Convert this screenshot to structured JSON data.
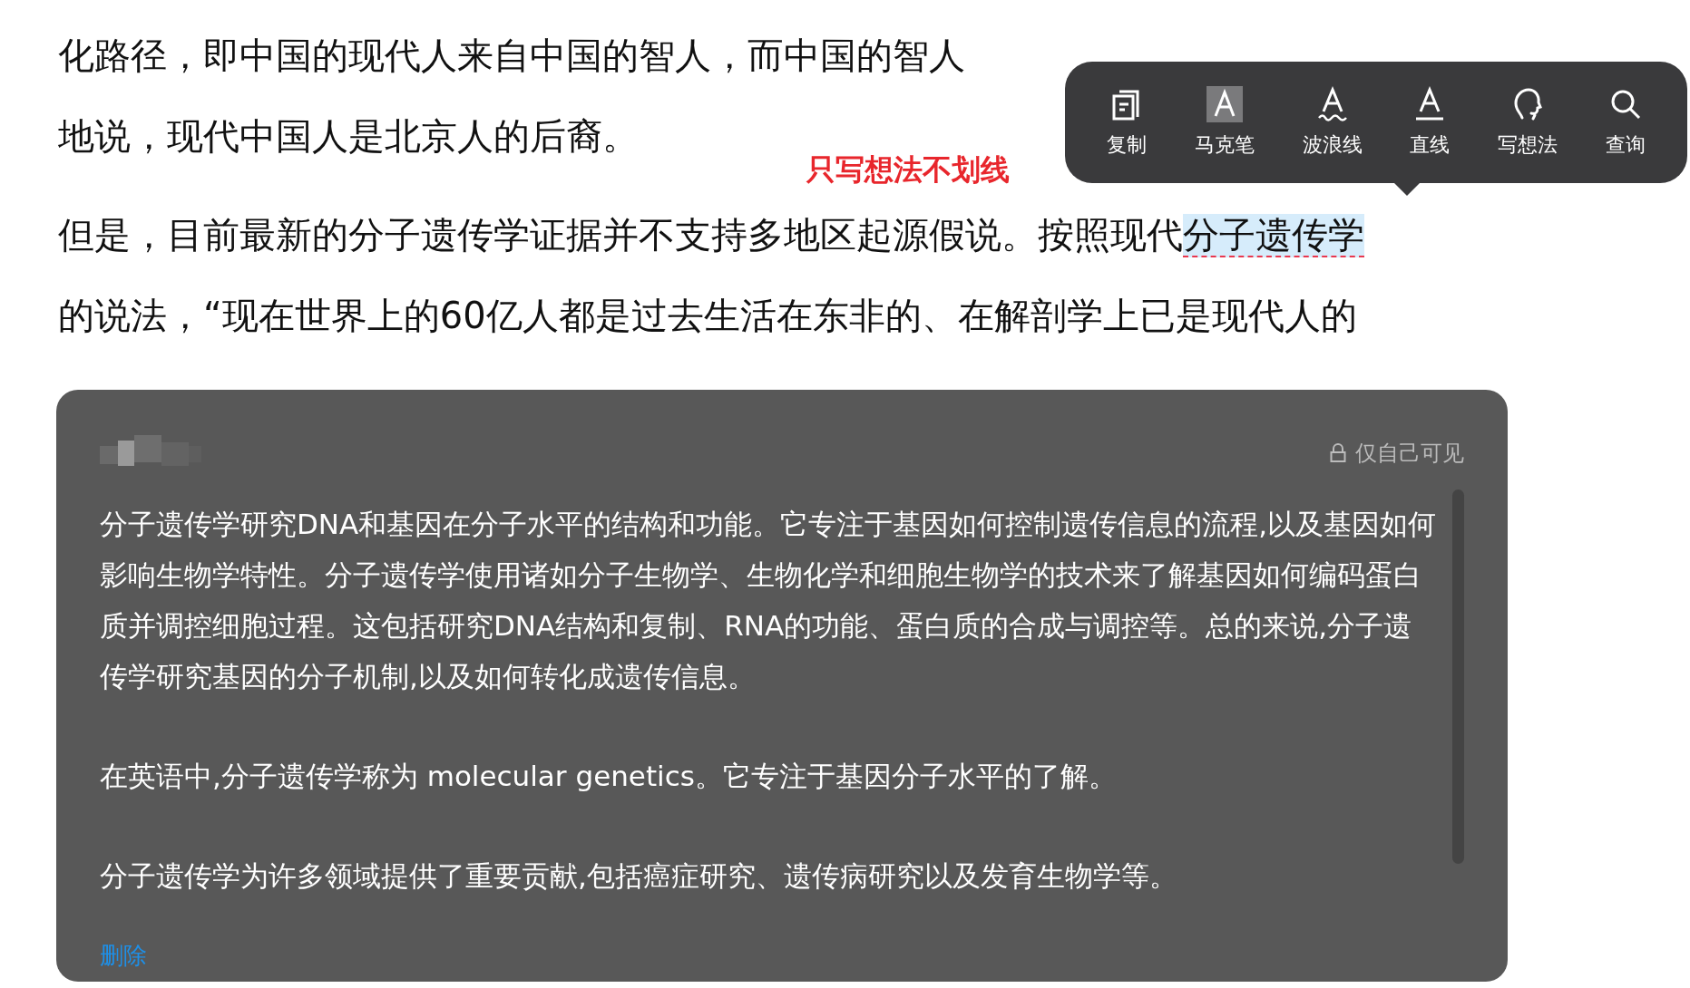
{
  "article": {
    "paragraphs": [
      {
        "lines": [
          [
            {
              "text": "化路径，即中国的现代人来自中国的智人，而中国的智人",
              "highlighted": false
            }
          ],
          [
            {
              "text": "地说，现代中国人是北京人的后裔。",
              "highlighted": false
            }
          ]
        ]
      },
      {
        "lines": [
          [
            {
              "text": "但是，目前最新的分子遗传学证据并不支持多地区起源假说。按照现代",
              "highlighted": false
            },
            {
              "text": "分子遗传学",
              "highlighted": true
            }
          ],
          [
            {
              "text": "的说法，“现在世界上的60亿人都是过去生活在东非的、在解剖学上已是现代人的",
              "highlighted": false
            }
          ]
        ]
      }
    ]
  },
  "annotation": "只写想法不划线",
  "toolbar": [
    {
      "kind": "copy",
      "label": "复制"
    },
    {
      "kind": "marker",
      "label": "马克笔"
    },
    {
      "kind": "wavy",
      "label": "波浪线"
    },
    {
      "kind": "straight",
      "label": "直线"
    },
    {
      "kind": "note",
      "label": "写想法"
    },
    {
      "kind": "search",
      "label": "查询"
    }
  ],
  "note": {
    "visibility": "仅自己可见",
    "paragraphs": [
      "分子遗传学研究DNA和基因在分子水平的结构和功能。它专注于基因如何控制遗传信息的流程,以及基因如何影响生物学特性。分子遗传学使用诸如分子生物学、生物化学和细胞生物学的技术来了解基因如何编码蛋白质并调控细胞过程。这包括研究DNA结构和复制、RNA的功能、蛋白质的合成与调控等。总的来说,分子遗传学研究基因的分子机制,以及如何转化成遗传信息。",
      "在英语中,分子遗传学称为 molecular genetics。它专注于基因分子水平的了解。",
      "分子遗传学为许多领域提供了重要贡献,包括癌症研究、遗传病研究以及发育生物学等。"
    ],
    "delete_label": "删除"
  }
}
